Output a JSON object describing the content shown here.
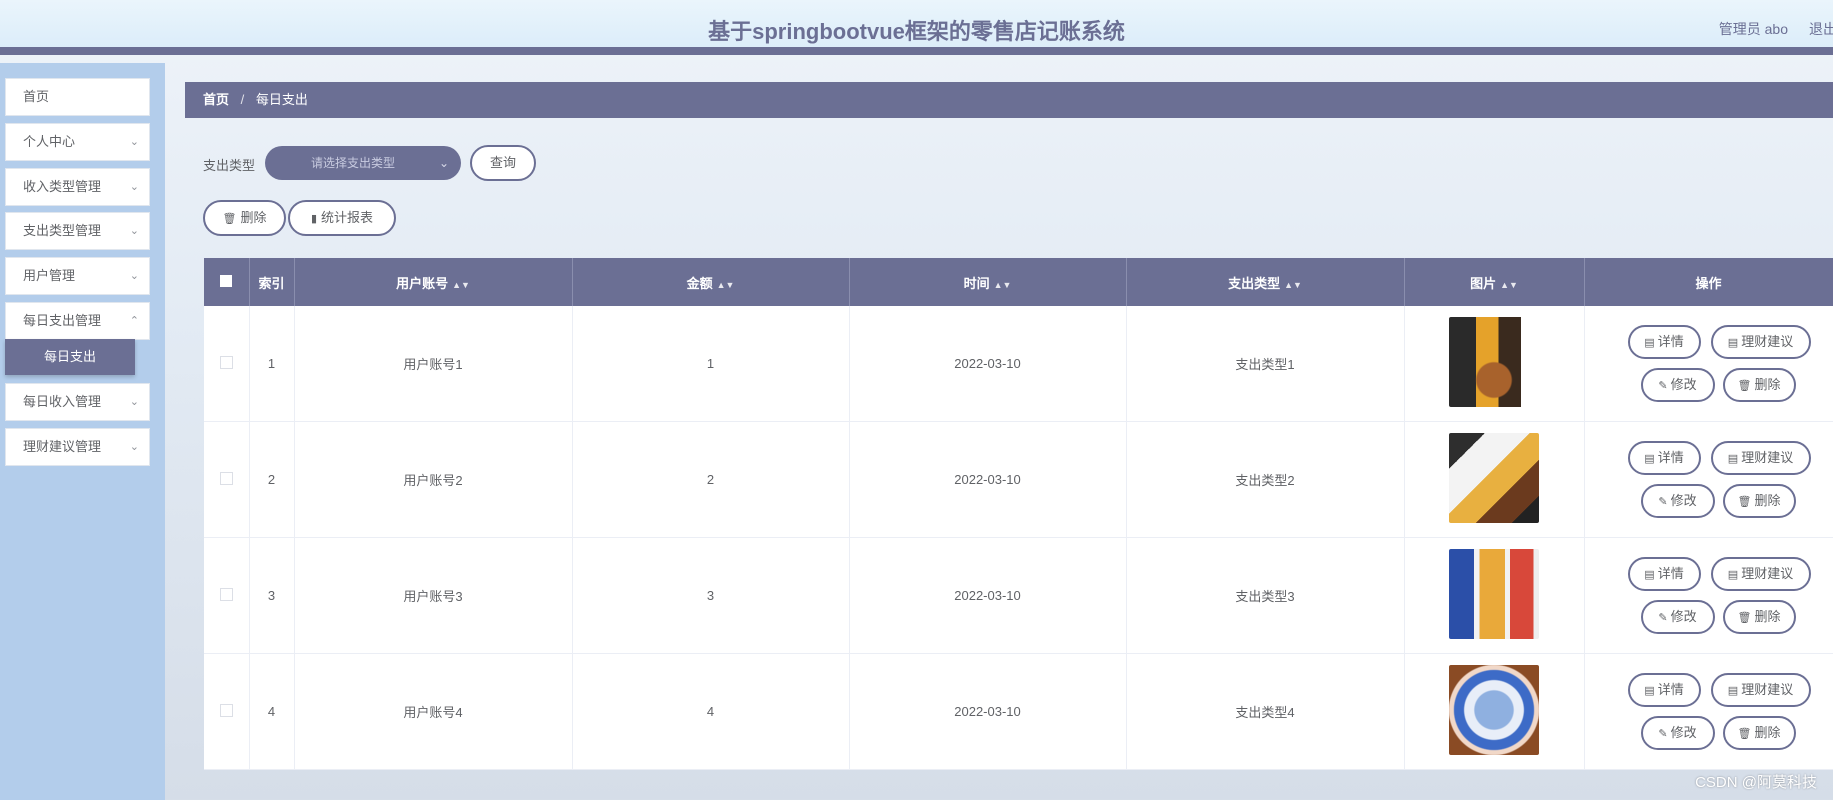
{
  "header": {
    "title": "基于springbootvue框架的零售店记账系统",
    "user": "管理员 abo",
    "logout": "退出"
  },
  "sidebar": {
    "items": [
      {
        "label": "首页",
        "has_children": false
      },
      {
        "label": "个人中心",
        "has_children": true
      },
      {
        "label": "收入类型管理",
        "has_children": true
      },
      {
        "label": "支出类型管理",
        "has_children": true
      },
      {
        "label": "用户管理",
        "has_children": true
      },
      {
        "label": "每日支出管理",
        "has_children": true
      },
      {
        "label": "每日收入管理",
        "has_children": true
      },
      {
        "label": "理财建议管理",
        "has_children": true
      }
    ],
    "active_sub": "每日支出"
  },
  "breadcrumb": {
    "home": "首页",
    "separator": "/",
    "current": "每日支出"
  },
  "filter": {
    "label": "支出类型",
    "placeholder": "请选择支出类型",
    "query_button": "查询"
  },
  "toolbar": {
    "delete_button": "删除",
    "report_button": "统计报表"
  },
  "table": {
    "headers": {
      "index": "索引",
      "account": "用户账号",
      "amount": "金额",
      "time": "时间",
      "type": "支出类型",
      "image": "图片",
      "actions": "操作"
    },
    "rows": [
      {
        "index": "1",
        "account": "用户账号1",
        "amount": "1",
        "time": "2022-03-10",
        "type": "支出类型1",
        "image": "snack-bags"
      },
      {
        "index": "2",
        "account": "用户账号2",
        "amount": "2",
        "time": "2022-03-10",
        "type": "支出类型2",
        "image": "burger-fries"
      },
      {
        "index": "3",
        "account": "用户账号3",
        "amount": "3",
        "time": "2022-03-10",
        "type": "支出类型3",
        "image": "milk-cartons"
      },
      {
        "index": "4",
        "account": "用户账号4",
        "amount": "4",
        "time": "2022-03-10",
        "type": "支出类型4",
        "image": "candy-bowl"
      }
    ],
    "row_actions": {
      "detail": "详情",
      "advice": "理财建议",
      "edit": "修改",
      "delete": "删除"
    }
  },
  "watermark": "CSDN @阿莫科技",
  "colors": {
    "primary": "#6b6f94",
    "sidebar_bg": "#b3cdeb",
    "header_bg": "#dcedf9"
  }
}
